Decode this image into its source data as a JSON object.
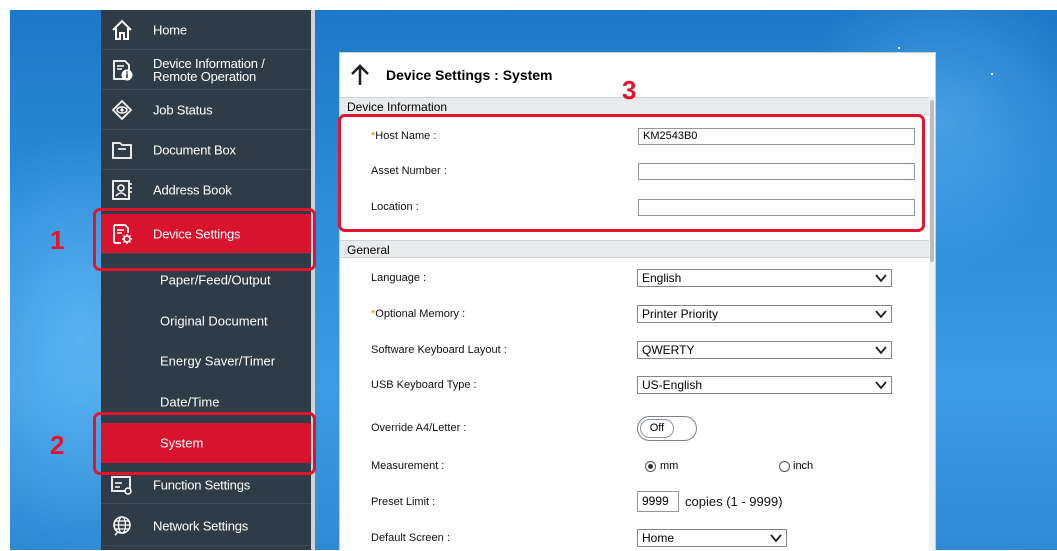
{
  "sidebar": {
    "items": [
      {
        "label": "Home",
        "icon": "home-icon"
      },
      {
        "label": "Device Information /\nRemote Operation",
        "icon": "device-info-icon"
      },
      {
        "label": "Job Status",
        "icon": "job-status-icon"
      },
      {
        "label": "Document Box",
        "icon": "document-box-icon"
      },
      {
        "label": "Address Book",
        "icon": "address-book-icon"
      },
      {
        "label": "Device Settings",
        "icon": "device-settings-icon"
      }
    ],
    "sub_items": [
      {
        "label": "Paper/Feed/Output"
      },
      {
        "label": "Original Document"
      },
      {
        "label": "Energy Saver/Timer"
      },
      {
        "label": "Date/Time"
      },
      {
        "label": "System"
      }
    ],
    "bottom_items": [
      {
        "label": "Function Settings",
        "icon": "function-settings-icon"
      },
      {
        "label": "Network Settings",
        "icon": "network-settings-icon"
      }
    ]
  },
  "panel": {
    "title": "Device Settings : System",
    "device_info": {
      "heading": "Device Information",
      "host_name_label": "Host Name :",
      "host_name_required": "*",
      "host_name_value": "KM2543B0",
      "asset_number_label": "Asset Number :",
      "asset_number_value": "",
      "location_label": "Location :",
      "location_value": ""
    },
    "general": {
      "heading": "General",
      "language_label": "Language :",
      "language_value": "English",
      "optional_memory_label": "Optional Memory :",
      "optional_memory_required": "*",
      "optional_memory_value": "Printer Priority",
      "keyboard_layout_label": "Software Keyboard Layout :",
      "keyboard_layout_value": "QWERTY",
      "usb_keyboard_label": "USB Keyboard Type :",
      "usb_keyboard_value": "US-English",
      "override_label": "Override A4/Letter :",
      "override_value": "Off",
      "measurement_label": "Measurement :",
      "measurement_mm": "mm",
      "measurement_inch": "inch",
      "measurement_selected": "mm",
      "preset_limit_label": "Preset Limit :",
      "preset_limit_value": "9999",
      "preset_limit_suffix": "copies (1 - 9999)",
      "default_screen_label": "Default Screen :",
      "default_screen_value": "Home"
    }
  },
  "callouts": {
    "step1": "1",
    "step2": "2",
    "step3": "3"
  },
  "colors": {
    "accent_red": "#d8132e",
    "callout_red": "#e4142a",
    "sidebar_bg": "#2f3b46",
    "required": "#e08a00"
  }
}
